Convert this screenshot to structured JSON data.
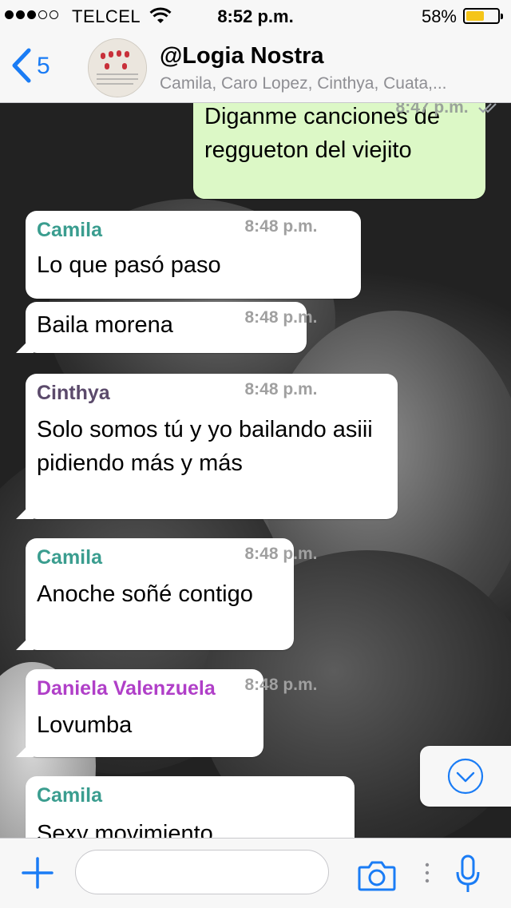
{
  "status": {
    "carrier": "TELCEL",
    "time": "8:52 p.m.",
    "battery_percent": "58%",
    "battery_level": 0.58,
    "signal_bars_filled": 3,
    "signal_bars_total": 5
  },
  "header": {
    "back_count": "5",
    "title": "@Logia Nostra",
    "members": "Camila, Caro Lopez, Cinthya, Cuata,..."
  },
  "messages": [
    {
      "sender": "",
      "text": "Diganme canciones de reggueton del viejito",
      "time": "8:47 p.m.",
      "outgoing": true
    },
    {
      "sender": "Camila",
      "text": "Lo que pasó paso",
      "time": "8:48 p.m."
    },
    {
      "sender": "",
      "text": "Baila morena",
      "time": "8:48 p.m."
    },
    {
      "sender": "Cinthya",
      "text": "Solo somos tú y yo bailando asiii pidiendo más y más",
      "time": "8:48 p.m."
    },
    {
      "sender": "Camila",
      "text": "Anoche soñé contigo",
      "time": "8:48 p.m."
    },
    {
      "sender": "Daniela Valenzuela",
      "text": "Lovumba",
      "time": "8:48 p.m."
    },
    {
      "sender": "Camila",
      "text": "Sexy movimiento",
      "time": ""
    }
  ],
  "colors": {
    "accent": "#1a7cf5",
    "camila": "#3a9d8f",
    "cinthya": "#5b4a6b",
    "daniela": "#b03fc8",
    "outgoing_bubble": "#dcf8c6",
    "read_checks": "#9aa0a6"
  },
  "input": {
    "placeholder": "",
    "value": ""
  },
  "icons": [
    "back-chevron-icon",
    "wifi-icon",
    "chevron-down-icon",
    "plus-icon",
    "camera-icon",
    "more-dots-icon",
    "microphone-icon"
  ]
}
